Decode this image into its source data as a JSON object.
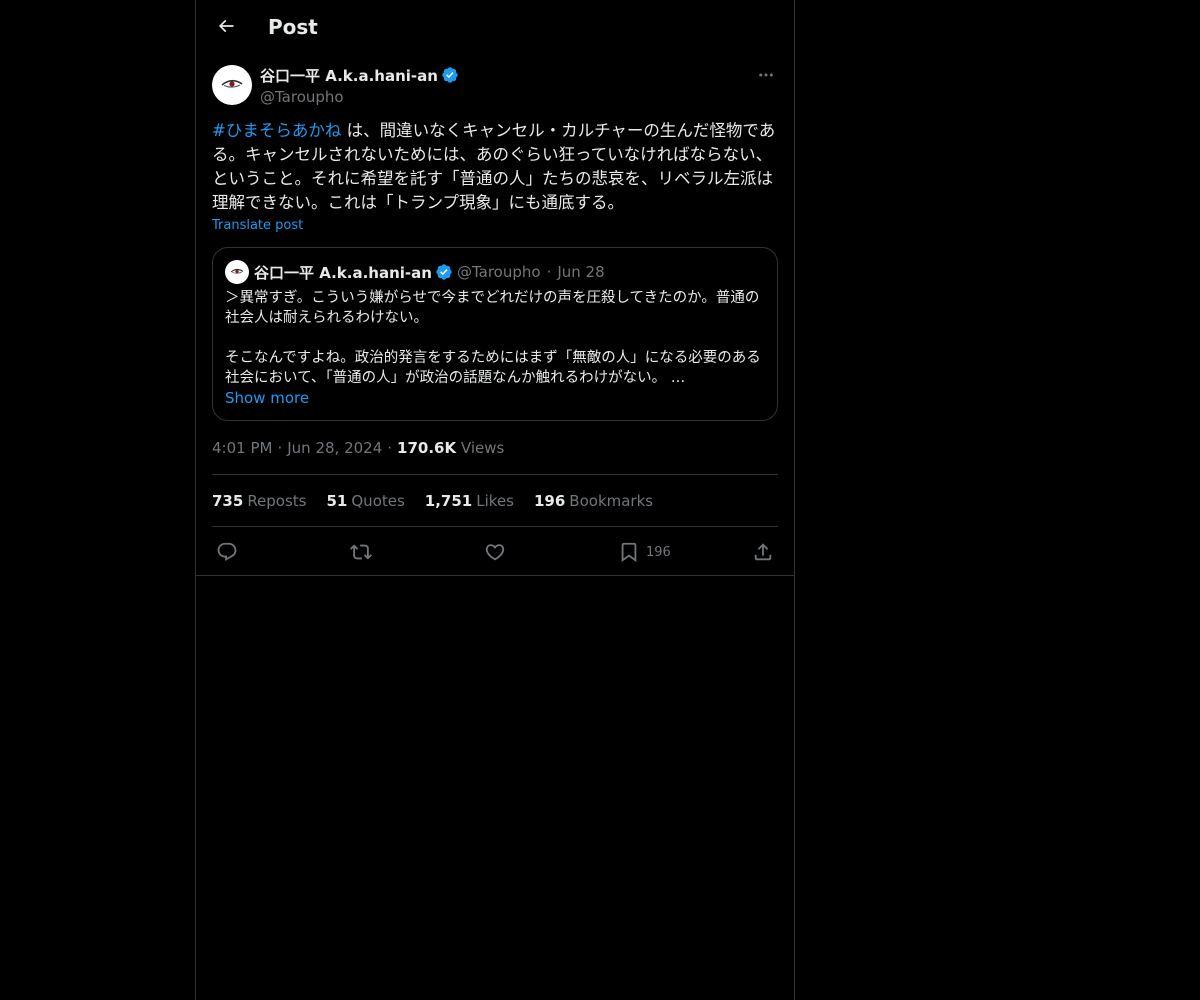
{
  "header": {
    "title": "Post",
    "back_icon": "arrow-left-icon"
  },
  "post": {
    "author_name": "谷口一平 A.k.a.hani-an",
    "author_handle": "@Taroupho",
    "verified": true,
    "hashtag": "#ひまそらあかね",
    "text": " は、間違いなくキャンセル・カルチャーの生んだ怪物である。キャンセルされないためには、あのぐらい狂っていなければならない、ということ。それに希望を託す「普通の人」たちの悲哀を、リベラル左派は理解できない。これは「トランプ現象」にも通底する。",
    "translate_label": "Translate post",
    "quote": {
      "author_name": "谷口一平 A.k.a.hani-an",
      "author_handle": "@Taroupho",
      "separator": "·",
      "date": "Jun 28",
      "paragraph1": "＞異常すぎ。こういう嫌がらせで今までどれだけの声を圧殺してきたのか。普通の社会人は耐えられるわけない。",
      "paragraph2": "そこなんですよね。政治的発言をするためにはまず「無敵の人」になる必要のある社会において、「普通の人」が政治の話題なんか触れるわけがない。 …",
      "show_more": "Show more"
    },
    "time": "4:01 PM",
    "date": "Jun 28, 2024",
    "separator": "·",
    "views_count": "170.6K",
    "views_label": "Views",
    "stats": [
      {
        "count": "735",
        "label": "Reposts"
      },
      {
        "count": "51",
        "label": "Quotes"
      },
      {
        "count": "1,751",
        "label": "Likes"
      },
      {
        "count": "196",
        "label": "Bookmarks"
      }
    ],
    "actions": {
      "reply_icon": "reply-icon",
      "repost_icon": "repost-icon",
      "like_icon": "heart-icon",
      "bookmark_icon": "bookmark-icon",
      "bookmark_count": "196",
      "share_icon": "share-icon"
    }
  },
  "colors": {
    "background": "#000000",
    "text": "#e7e9ea",
    "secondary": "#71767b",
    "accent": "#1d9bf0",
    "border": "#2f3336"
  }
}
